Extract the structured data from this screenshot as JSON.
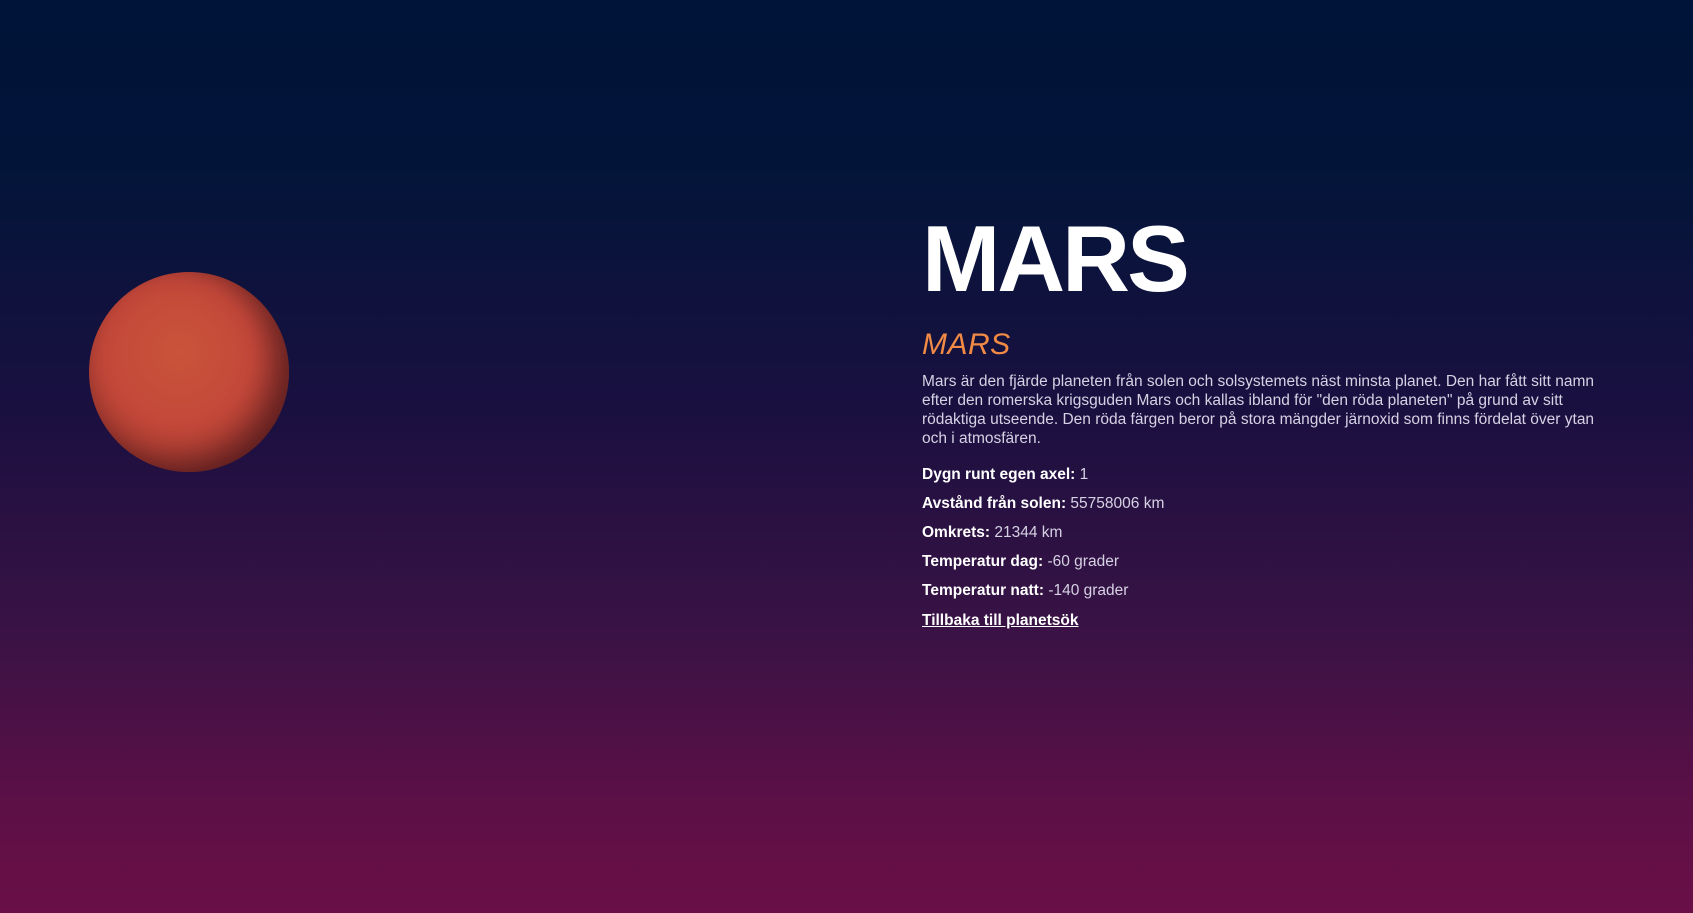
{
  "planet": {
    "name": "MARS",
    "latin_name": "MARS",
    "color": "#c4483a",
    "description": "Mars är den fjärde planeten från solen och solsystemets näst minsta planet. Den har fått sitt namn efter den romerska krigsguden Mars och kallas ibland för \"den röda planeten\" på grund av sitt rödaktiga utseende. Den röda färgen beror på stora mängder järnoxid som finns fördelat över ytan och i atmosfären."
  },
  "facts": [
    {
      "label": "Dygn runt egen axel:",
      "value": " 1"
    },
    {
      "label": "Avstånd från solen:",
      "value": " 55758006 km"
    },
    {
      "label": "Omkrets:",
      "value": " 21344 km"
    },
    {
      "label": "Temperatur dag:",
      "value": " -60 grader"
    },
    {
      "label": "Temperatur natt:",
      "value": " -140 grader"
    }
  ],
  "back_link": "Tillbaka till planetsök",
  "colors": {
    "accent": "#f08a44",
    "background_top": "#001338",
    "background_bottom": "#6a0f47"
  }
}
